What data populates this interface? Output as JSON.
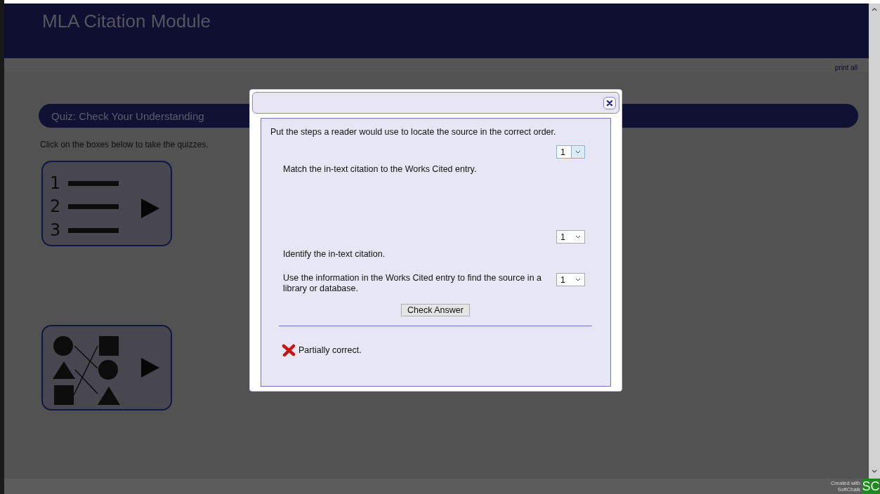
{
  "header": {
    "title": "MLA Citation Module",
    "print_link": "print all"
  },
  "section": {
    "title": "Quiz: Check Your Understanding",
    "instructions": "Click on the boxes below to take the quizzes."
  },
  "quiz_tiles": [
    {
      "kind": "ordering",
      "labels": [
        "1",
        "2",
        "3"
      ]
    },
    {
      "kind": "matching"
    }
  ],
  "dialog": {
    "prompt": "Put the steps a reader would use to locate the source in the correct order.",
    "steps": [
      {
        "kind": "stacked",
        "text": "Match the in-text citation to the Works Cited entry.",
        "value": "1",
        "focused": true
      },
      {
        "kind": "stacked",
        "text": "Identify the in-text citation.",
        "value": "1",
        "focused": false
      },
      {
        "kind": "inline",
        "text": "Use the information in the Works Cited entry to find the source in a library or database.",
        "value": "1",
        "focused": false
      }
    ],
    "check_button": "Check Answer",
    "feedback": {
      "kind": "wrong",
      "text": "Partially correct."
    }
  },
  "footer": {
    "credit_lines": [
      "Created with",
      "SoftChalk"
    ],
    "logo": "SC"
  }
}
